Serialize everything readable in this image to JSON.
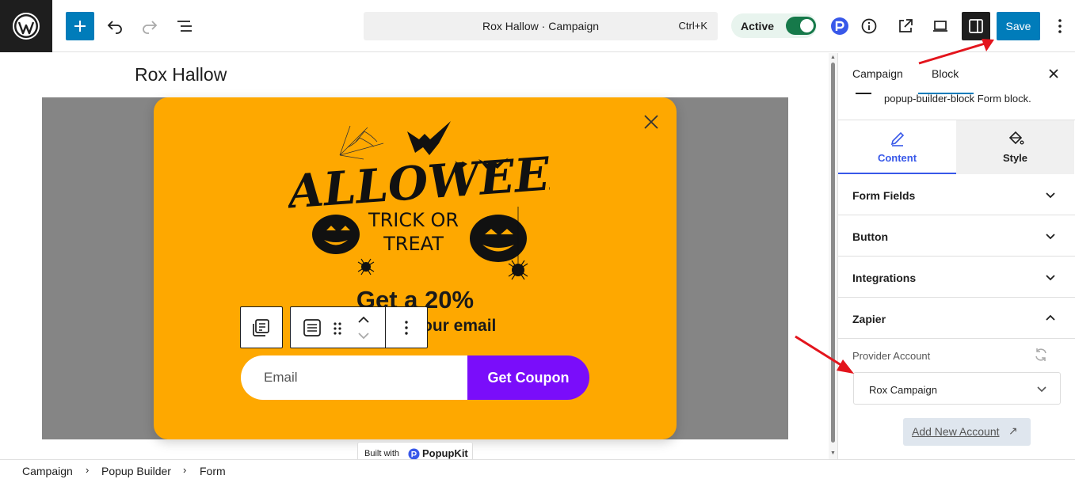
{
  "topbar": {
    "command": {
      "title": "Rox Hallow · Campaign",
      "shortcut": "Ctrl+K"
    },
    "status": {
      "label": "Active",
      "enabled": true
    },
    "save_label": "Save"
  },
  "canvas": {
    "page_title": "Rox Hallow",
    "popup": {
      "art_icon": "halloween-trick-or-treat-illustration",
      "headline_1": "Get a 20%",
      "headline_2": "our email",
      "email_placeholder": "Email",
      "button_label": "Get Coupon"
    },
    "built_with": {
      "text": "Built with",
      "brand": "PopupKit"
    }
  },
  "sidebar": {
    "tabs": [
      {
        "label": "Campaign"
      },
      {
        "label": "Block"
      }
    ],
    "block_description": "popup-builder-block Form block.",
    "content_tabs": [
      {
        "label": "Content",
        "icon": "pencil-icon"
      },
      {
        "label": "Style",
        "icon": "paint-bucket-icon"
      }
    ],
    "panels": [
      {
        "label": "Form Fields",
        "open": false
      },
      {
        "label": "Button",
        "open": false
      },
      {
        "label": "Integrations",
        "open": false
      },
      {
        "label": "Zapier",
        "open": true
      }
    ],
    "zapier": {
      "provider_label": "Provider Account",
      "selected_account": "Rox Campaign",
      "add_account_label": "Add New Account",
      "add_account_arrow": "↗"
    }
  },
  "breadcrumb": [
    "Campaign",
    "Popup Builder",
    "Form"
  ],
  "colors": {
    "accent": "#007cba",
    "popup_bg": "#fea800",
    "coupon_button": "#7a0dfa",
    "toggle_on": "#16794a",
    "annotation": "#e3141c"
  }
}
